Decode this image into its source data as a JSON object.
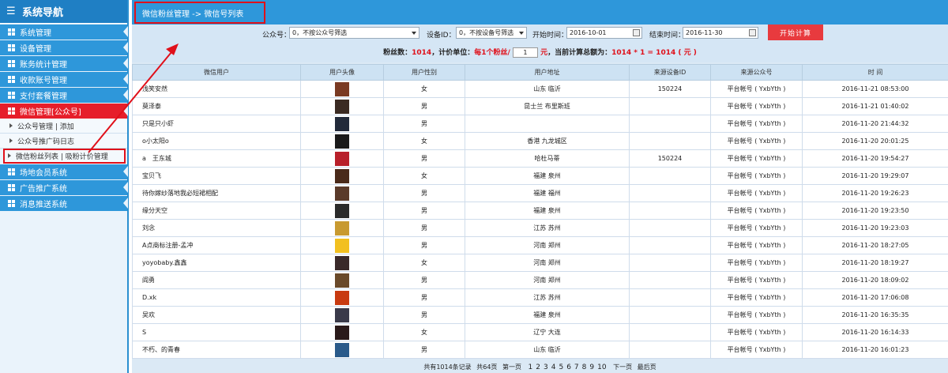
{
  "sidebar": {
    "title": "系统导航",
    "items": [
      {
        "label": "系统管理",
        "active": false
      },
      {
        "label": "设备管理",
        "active": false
      },
      {
        "label": "账务统计管理",
        "active": false
      },
      {
        "label": "收款账号管理",
        "active": false
      },
      {
        "label": "支付套餐管理",
        "active": false
      },
      {
        "label": "微信管理[公众号]",
        "active": true
      }
    ],
    "subitems": [
      {
        "label": "公众号管理 | 添加",
        "highlight": false
      },
      {
        "label": "公众号推广码日志",
        "highlight": false
      },
      {
        "label": "微信粉丝列表 | 吸粉计价管理",
        "highlight": true
      }
    ],
    "items2": [
      {
        "label": "场地会员系统"
      },
      {
        "label": "广告推广系统"
      },
      {
        "label": "消息推送系统"
      }
    ]
  },
  "breadcrumb": {
    "text": "微信粉丝管理 -> 微信号列表"
  },
  "filters": {
    "account_label": "公众号：",
    "account_value": "0，不按公众号筛选",
    "device_label": "设备ID：",
    "device_value": "0，不按设备号筛选",
    "start_label": "开始时间：",
    "start_value": "2016-10-01",
    "end_label": "结束时间：",
    "end_value": "2016-11-30",
    "button": "开始计算"
  },
  "summary": {
    "fans_label": "粉丝数：",
    "fans_value": "1014",
    "unit_label": "，计价单位：",
    "unit_text": "每1个粉丝/",
    "unit_input": "1",
    "unit_yuan": "元",
    "total_label": "，当前计算总额为：",
    "total_value": "1014 * 1 = 1014 ( 元 )"
  },
  "table": {
    "headers": [
      "微信用户",
      "用户头像",
      "用户性别",
      "用户地址",
      "来源设备ID",
      "来源公众号",
      "时 间"
    ],
    "rows": [
      {
        "user": "浅笑安然",
        "gender": "女",
        "addr": "山东 临沂",
        "dev": "150224",
        "src": "平台帐号 ( YxbYth )",
        "time": "2016-11-21 08:53:00",
        "av": "#7a3a22"
      },
      {
        "user": "莫泽泰",
        "gender": "男",
        "addr": "昆士兰 布里斯班",
        "dev": "",
        "src": "平台帐号 ( YxbYth )",
        "time": "2016-11-21 01:40:02",
        "av": "#3a2a22"
      },
      {
        "user": "只是只小虾",
        "gender": "男",
        "addr": "",
        "dev": "",
        "src": "平台帐号 ( YxbYth )",
        "time": "2016-11-20 21:44:32",
        "av": "#222a3a"
      },
      {
        "user": "o小太阳o",
        "gender": "女",
        "addr": "香港 九龙城区",
        "dev": "",
        "src": "平台帐号 ( YxbYth )",
        "time": "2016-11-20 20:01:25",
        "av": "#1a1a1a"
      },
      {
        "user": "a　王东城",
        "gender": "男",
        "addr": "哈杜马蒂",
        "dev": "150224",
        "src": "平台帐号 ( YxbYth )",
        "time": "2016-11-20 19:54:27",
        "av": "#b8202a"
      },
      {
        "user": "宝贝飞",
        "gender": "女",
        "addr": "福建 泉州",
        "dev": "",
        "src": "平台帐号 ( YxbYth )",
        "time": "2016-11-20 19:29:07",
        "av": "#4a2a1a"
      },
      {
        "user": "待你嫁纱落地我必短裙相配",
        "gender": "男",
        "addr": "福建 福州",
        "dev": "",
        "src": "平台帐号 ( YxbYth )",
        "time": "2016-11-20 19:26:23",
        "av": "#5a3a2a"
      },
      {
        "user": "缘分天空",
        "gender": "男",
        "addr": "福建 泉州",
        "dev": "",
        "src": "平台帐号 ( YxbYth )",
        "time": "2016-11-20 19:23:50",
        "av": "#2a2a2a"
      },
      {
        "user": "刘念",
        "gender": "男",
        "addr": "江苏 苏州",
        "dev": "",
        "src": "平台帐号 ( YxbYth )",
        "time": "2016-11-20 19:23:03",
        "av": "#c89a30"
      },
      {
        "user": "A点商标注册-孟冲",
        "gender": "男",
        "addr": "河南 郑州",
        "dev": "",
        "src": "平台帐号 ( YxbYth )",
        "time": "2016-11-20 18:27:05",
        "av": "#f2c020"
      },
      {
        "user": "yoyobaby.鑫鑫",
        "gender": "女",
        "addr": "河南 郑州",
        "dev": "",
        "src": "平台帐号 ( YxbYth )",
        "time": "2016-11-20 18:19:27",
        "av": "#3a2a2a"
      },
      {
        "user": "阎勇",
        "gender": "男",
        "addr": "河南 郑州",
        "dev": "",
        "src": "平台帐号 ( YxbYth )",
        "time": "2016-11-20 18:09:02",
        "av": "#6a4a2a"
      },
      {
        "user": "D.xk",
        "gender": "男",
        "addr": "江苏 苏州",
        "dev": "",
        "src": "平台帐号 ( YxbYth )",
        "time": "2016-11-20 17:06:08",
        "av": "#c83a10"
      },
      {
        "user": "吴欢",
        "gender": "男",
        "addr": "福建 泉州",
        "dev": "",
        "src": "平台帐号 ( YxbYth )",
        "time": "2016-11-20 16:35:35",
        "av": "#3a3a4a"
      },
      {
        "user": "S",
        "gender": "女",
        "addr": "辽宁 大连",
        "dev": "",
        "src": "平台帐号 ( YxbYth )",
        "time": "2016-11-20 16:14:33",
        "av": "#2a1a1a"
      },
      {
        "user": "不朽、的青春",
        "gender": "男",
        "addr": "山东 临沂",
        "dev": "",
        "src": "平台帐号 ( YxbYth )",
        "time": "2016-11-20 16:01:23",
        "av": "#2a5a8a"
      }
    ]
  },
  "pager": {
    "total": "共有1014条记录",
    "pages": "共64页",
    "first": "第一页",
    "numbers": [
      "1",
      "2",
      "3",
      "4",
      "5",
      "6",
      "7",
      "8",
      "9",
      "10"
    ],
    "next": "下一页",
    "last": "最后页"
  },
  "colors": {
    "accent": "#2e97da",
    "active": "#e61e2a",
    "highlight": "#e0101a"
  }
}
